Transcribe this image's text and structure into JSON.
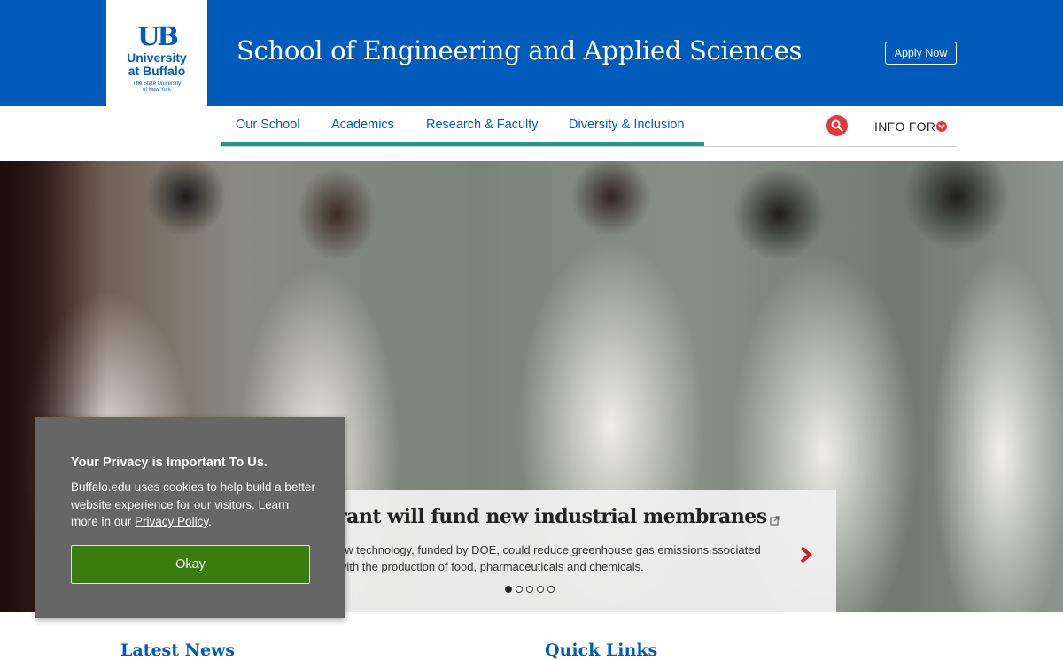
{
  "header": {
    "logo": {
      "mark": "UB",
      "line1": "University",
      "line2": "at Buffalo",
      "small1": "The State University",
      "small2": "of New York"
    },
    "title": "School of Engineering and Applied Sciences",
    "apply_label": "Apply Now"
  },
  "nav": {
    "items": [
      "Our School",
      "Academics",
      "Research & Faculty",
      "Diversity & Inclusion"
    ],
    "info_for": "INFO FOR"
  },
  "hero": {
    "title": "rant will fund new industrial membranes",
    "text": "ew technology, funded by DOE, could reduce greenhouse gas emissions ssociated with the production of food, pharmaceuticals and chemicals.",
    "slide_count": 5,
    "active_slide": 1
  },
  "privacy": {
    "title": "Your Privacy is Important To Us.",
    "text": "Buffalo.edu uses cookies to help build a better website experience for our visitors. Learn more in our",
    "link": "Privacy Policy",
    "period": ".",
    "button": "Okay"
  },
  "sections": {
    "latest_news": "Latest News",
    "quick_links": "Quick Links"
  },
  "colors": {
    "brand_blue": "#005bbb",
    "accent_red": "#e0393e",
    "nav_teal": "#1a9a8f",
    "okay_green": "#3a7d0e"
  }
}
